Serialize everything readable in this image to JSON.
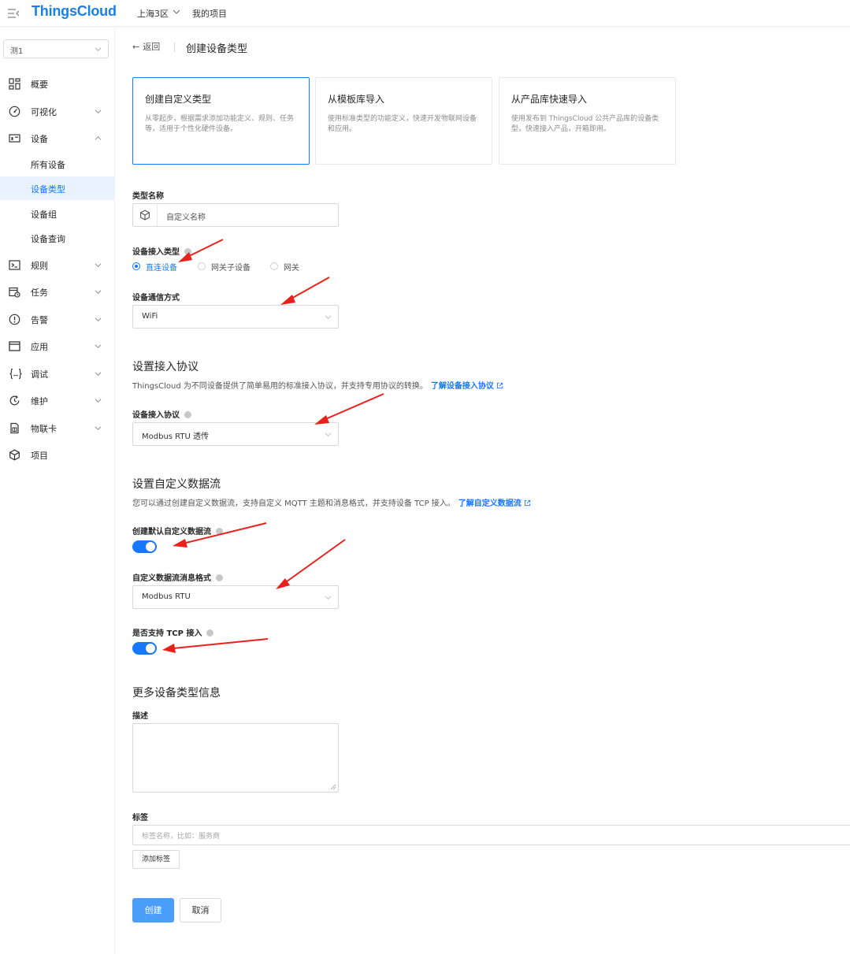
{
  "topbar": {
    "logo": "ThingsCloud",
    "region": "上海3区",
    "project_link": "我的项目"
  },
  "sidebar": {
    "project_select": "测1",
    "items": [
      {
        "label": "概要",
        "icon": "dashboard-icon"
      },
      {
        "label": "可视化",
        "icon": "gauge-icon"
      },
      {
        "label": "设备",
        "icon": "device-icon"
      },
      {
        "label": "规则",
        "icon": "terminal-icon"
      },
      {
        "label": "任务",
        "icon": "calendar-icon"
      },
      {
        "label": "告警",
        "icon": "alert-icon"
      },
      {
        "label": "应用",
        "icon": "window-icon"
      },
      {
        "label": "调试",
        "icon": "braces-icon"
      },
      {
        "label": "维护",
        "icon": "refresh-icon"
      },
      {
        "label": "物联卡",
        "icon": "sim-card-icon"
      },
      {
        "label": "项目",
        "icon": "cube-icon"
      }
    ],
    "sub_items": [
      "所有设备",
      "设备类型",
      "设备组",
      "设备查询"
    ],
    "active_sub": "设备类型"
  },
  "header": {
    "back_label": "返回",
    "title": "创建设备类型"
  },
  "cards": [
    {
      "title": "创建自定义类型",
      "desc": "从零起步，根据需求添加功能定义、规则、任务等，适用于个性化硬件设备。"
    },
    {
      "title": "从模板库导入",
      "desc": "使用标准类型的功能定义，快速开发物联网设备和应用。"
    },
    {
      "title": "从产品库快速导入",
      "desc": "使用发布到 ThingsCloud 公共产品库的设备类型，快速接入产品，开箱即用。"
    }
  ],
  "form": {
    "type_name_label": "类型名称",
    "type_name_placeholder": "自定义名称",
    "access_type_label": "设备接入类型",
    "access_options": [
      "直连设备",
      "网关子设备",
      "网关"
    ],
    "comm_label": "设备通信方式",
    "comm_value": "WiFi",
    "protocol_section_title": "设置接入协议",
    "protocol_section_desc": "ThingsCloud 为不同设备提供了简单易用的标准接入协议，并支持专用协议的转换。",
    "protocol_section_link": "了解设备接入协议",
    "protocol_label": "设备接入协议",
    "protocol_value": "Modbus RTU 透传",
    "stream_section_title": "设置自定义数据流",
    "stream_section_desc": "您可以通过创建自定义数据流，支持自定义 MQTT 主题和消息格式，并支持设备 TCP 接入。",
    "stream_section_link": "了解自定义数据流",
    "default_stream_label": "创建默认自定义数据流",
    "default_stream_on": true,
    "msg_format_label": "自定义数据流消息格式",
    "msg_format_value": "Modbus RTU",
    "tcp_label": "是否支持 TCP 接入",
    "tcp_on": true,
    "more_section_title": "更多设备类型信息",
    "desc_label": "描述",
    "tags_label": "标签",
    "tags_placeholder": "标签名称，比如：服务商",
    "add_tag_button": "添加标签",
    "create_button": "创建",
    "cancel_button": "取消"
  },
  "colors": {
    "accent": "#1677ff",
    "annotation_arrow": "#e8221b"
  }
}
